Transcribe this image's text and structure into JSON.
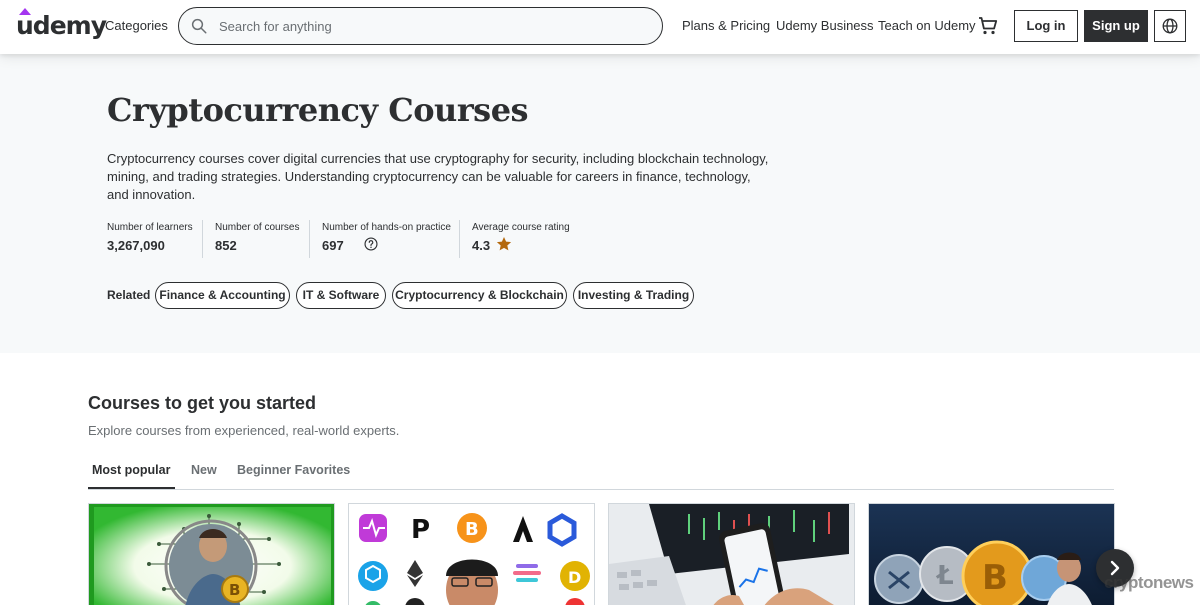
{
  "header": {
    "logo": "udemy",
    "categories": "Categories",
    "search_placeholder": "Search for anything",
    "plans": "Plans & Pricing",
    "business": "Udemy Business",
    "teach": "Teach on Udemy",
    "login": "Log in",
    "signup": "Sign up"
  },
  "hero": {
    "title": "Cryptocurrency Courses",
    "description": "Cryptocurrency courses cover digital currencies that use cryptography for security, including blockchain technology, mining, and trading strategies. Understanding cryptocurrency can be valuable for careers in finance, technology, and innovation.",
    "stats": [
      {
        "label": "Number of learners",
        "value": "3,267,090"
      },
      {
        "label": "Number of courses",
        "value": "852"
      },
      {
        "label": "Number of hands-on practice",
        "value": "697"
      },
      {
        "label": "Average course rating",
        "value": "4.3"
      }
    ],
    "related_label": "Related",
    "related": [
      "Finance & Accounting",
      "IT & Software",
      "Cryptocurrency & Blockchain",
      "Investing & Trading"
    ]
  },
  "courses": {
    "title": "Courses to get you started",
    "subtitle": "Explore courses from experienced, real-world experts.",
    "tabs": [
      "Most popular",
      "New",
      "Beginner Favorites"
    ]
  },
  "watermark": "cryptonews",
  "colors": {
    "brand": "#a435f0",
    "dark": "#2d2f31",
    "hero_bg": "#f7f9fa",
    "star": "#b4690e"
  }
}
